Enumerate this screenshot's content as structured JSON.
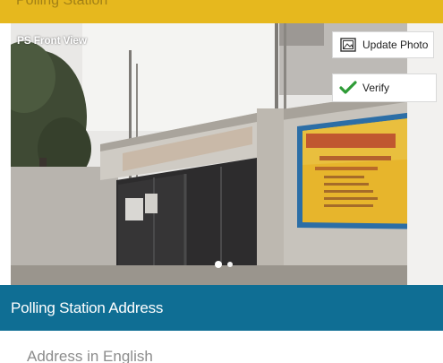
{
  "header": {
    "title": "Polling Station"
  },
  "photo": {
    "caption": "PS Front View",
    "update_label": "Update Photo",
    "verify_label": "Verify",
    "update_icon": "photo-frame-icon",
    "verify_icon": "checkmark-icon",
    "slide_count": 2,
    "active_slide": 1
  },
  "section": {
    "title": "Polling Station Address"
  },
  "address": {
    "english_label": "Address in English"
  },
  "colors": {
    "accent_yellow": "#e6b81e",
    "section_blue": "#0f6e94",
    "verify_green": "#2e9b36"
  }
}
